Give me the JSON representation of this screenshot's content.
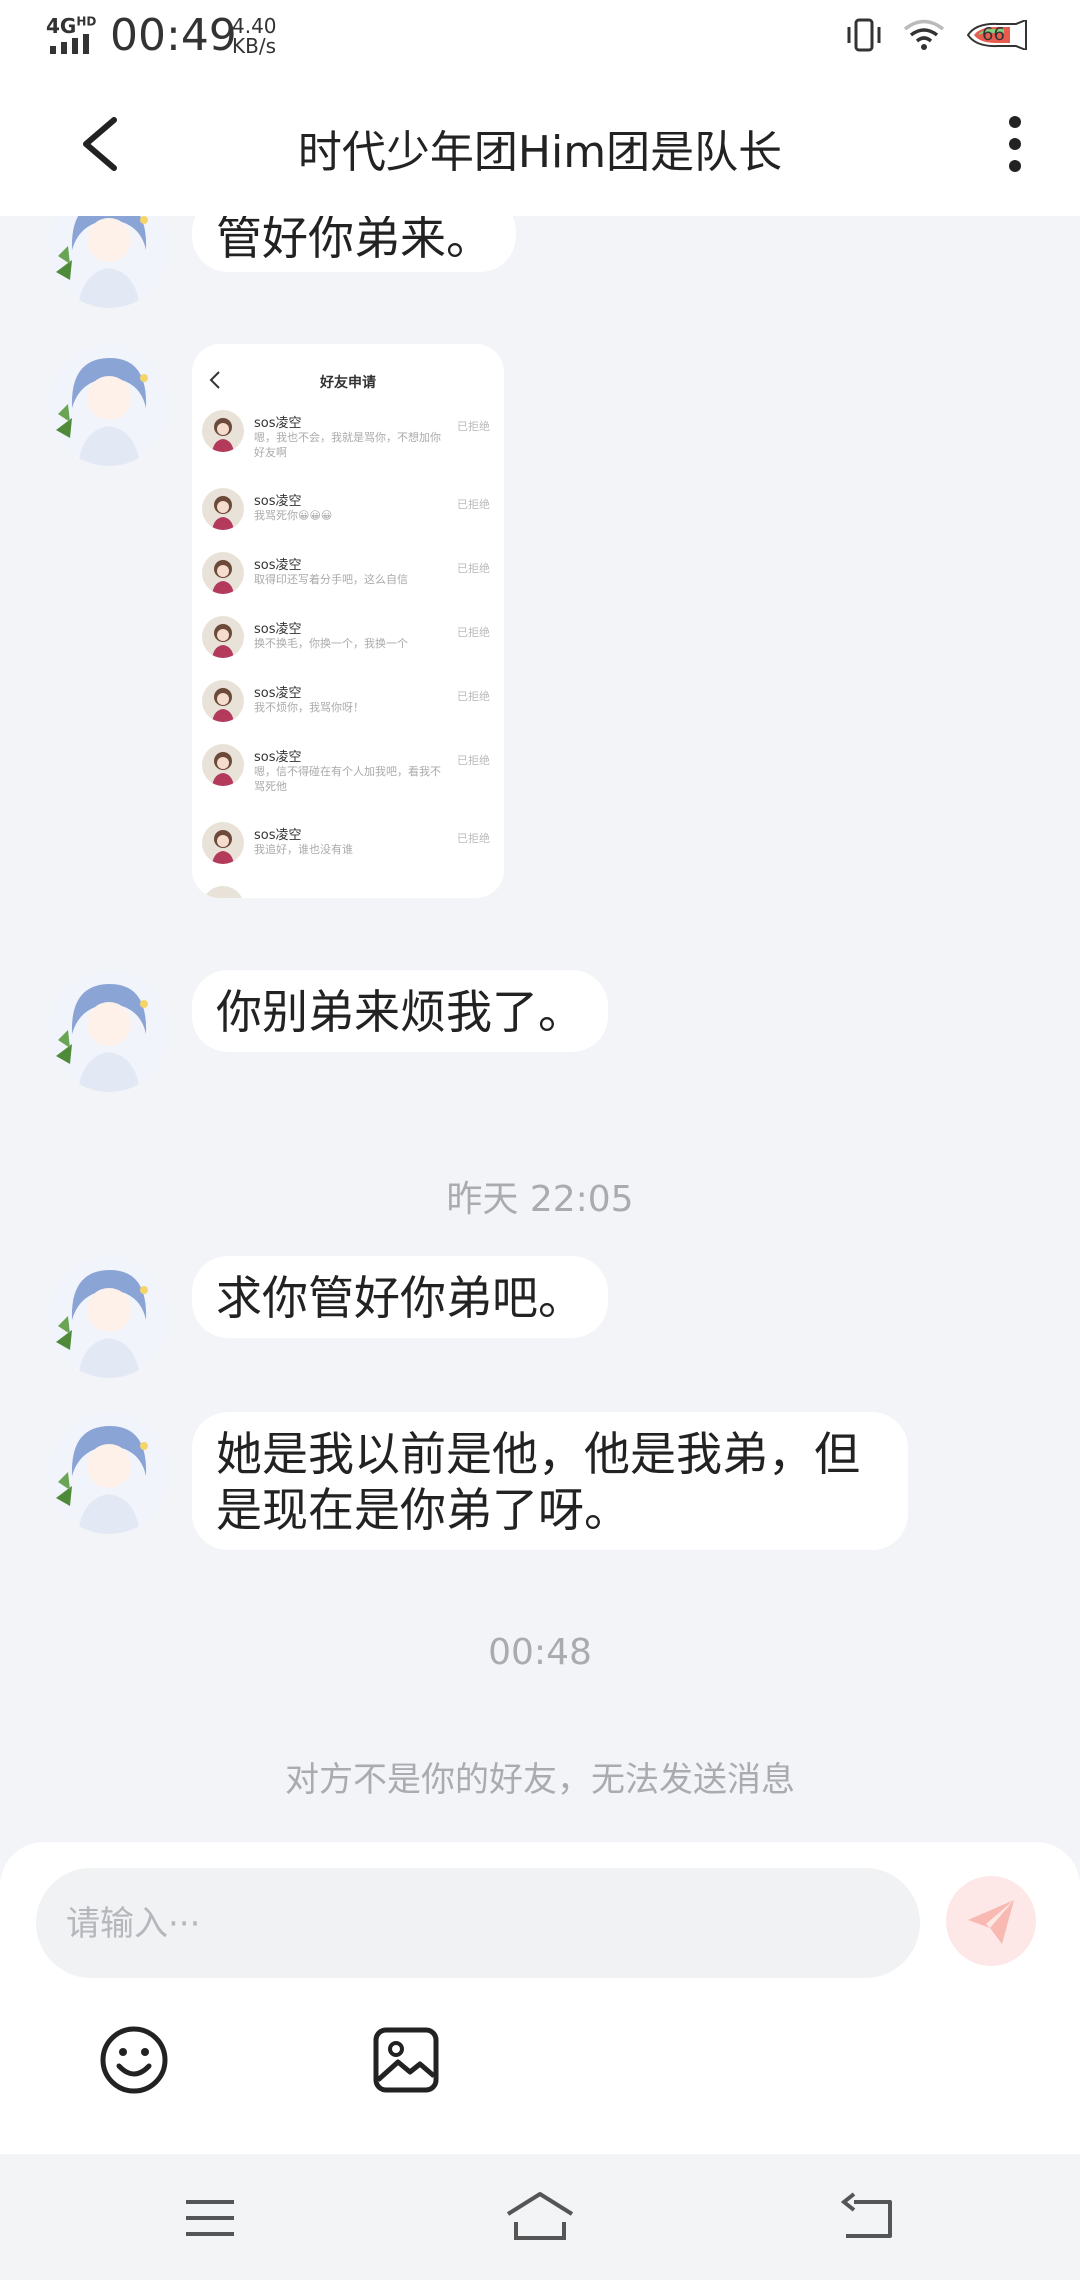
{
  "status_bar": {
    "network": "4G",
    "network_sup": "HD",
    "time": "00:49",
    "speed_value": "4.40",
    "speed_unit": "KB/s",
    "battery": "66"
  },
  "header": {
    "title": "时代少年团Him团是队长"
  },
  "messages": [
    {
      "type": "text",
      "text": "管好你弟来。"
    },
    {
      "type": "image"
    },
    {
      "type": "text",
      "text": "你别弟来烦我了。"
    },
    {
      "type": "timestamp",
      "text": "昨天 22:05"
    },
    {
      "type": "text",
      "text": "求你管好你弟吧。"
    },
    {
      "type": "text",
      "text": "她是我以前是他，他是我弟，但是现在是你弟了呀。"
    },
    {
      "type": "timestamp",
      "text": "00:48"
    }
  ],
  "shared_screenshot": {
    "title": "好友申请",
    "requests": [
      {
        "name": "sos凌空",
        "message": "嗯，我也不会，我就是骂你，不想加你好友啊",
        "status": "已拒绝"
      },
      {
        "name": "sos凌空",
        "message": "我骂死你😀😀😀",
        "status": "已拒绝"
      },
      {
        "name": "sos凌空",
        "message": "取得印还写着分手吧，这么自信",
        "status": "已拒绝"
      },
      {
        "name": "sos凌空",
        "message": "换不换毛，你换一个，我换一个",
        "status": "已拒绝"
      },
      {
        "name": "sos凌空",
        "message": "我不烦你，我骂你呀！",
        "status": "已拒绝"
      },
      {
        "name": "sos凌空",
        "message": "嗯，信不得碰在有个人加我吧，看我不骂死他",
        "status": "已拒绝"
      },
      {
        "name": "sos凌空",
        "message": "我追好，谁也没有谁",
        "status": "已拒绝"
      }
    ]
  },
  "notice": "对方不是你的好友，无法发送消息",
  "input": {
    "placeholder": "请输入···"
  },
  "colors": {
    "background": "#f3f4f7",
    "send_button": "#fde8e7",
    "send_icon": "#f8b9b3"
  }
}
